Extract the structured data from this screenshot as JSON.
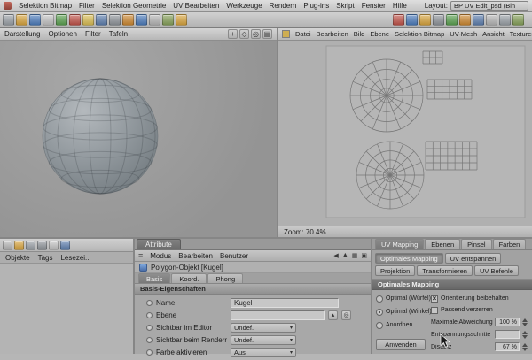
{
  "app": {
    "layout_label": "Layout:",
    "layout_value": "BP UV Edit_psd (Bin"
  },
  "menubar": {
    "items": [
      "Selektion Bitmap",
      "Filter",
      "Selektion Geometrie",
      "UV Bearbeiten",
      "Werkzeuge",
      "Rendern",
      "Plug-ins",
      "Skript",
      "Fenster",
      "Hilfe"
    ]
  },
  "toolbar": {
    "left_icons": [
      "#9aa0a6",
      "#d7a43f",
      "#4d7cbb",
      "#c2c2c2",
      "#5ba051",
      "#c0544a",
      "#d9bd55",
      "#5f7fae",
      "#8f949a",
      "#cc8833",
      "#4d7cbb",
      "#b5b5b5",
      "#86a05a",
      "#d7a43f"
    ],
    "right_icons": [
      "#c0544a",
      "#4d7cbb",
      "#d7a43f",
      "#8f949a",
      "#5ba051",
      "#cc8833",
      "#5f7fae",
      "#b5b5b5",
      "#9aa0a6",
      "#86a05a"
    ]
  },
  "viewport3d": {
    "menu": [
      "Darstellung",
      "Optionen",
      "Filter",
      "Tafeln"
    ]
  },
  "uv_view": {
    "menu": [
      "Datei",
      "Bearbeiten",
      "Bild",
      "Ebene",
      "Selektion Bitmap",
      "UV-Mesh",
      "Ansicht",
      "Texturen"
    ],
    "zoom_text": "Zoom: 70.4%"
  },
  "object_manager": {
    "toolbar_icons": [
      "#b5b5b5",
      "#d7a43f",
      "#9aa0a6",
      "#8f949a",
      "#c2c2c2",
      "#5f7fae"
    ],
    "tabs": [
      "Objekte",
      "Tags",
      "Lesezei..."
    ]
  },
  "attributes": {
    "panel_tab": "Attribute",
    "menu": [
      "Modus",
      "Bearbeiten",
      "Benutzer"
    ],
    "object_title": "Polygon-Objekt [Kugel]",
    "tabs": [
      "Basis",
      "Koord.",
      "Phong"
    ],
    "section": "Basis-Eigenschaften",
    "rows": [
      {
        "label": "Name",
        "value": "Kugel"
      },
      {
        "label": "Ebene",
        "value": ""
      },
      {
        "label": "Sichtbar im Editor",
        "value": "Undef."
      },
      {
        "label": "Sichtbar beim Rendern",
        "value": "Undef."
      },
      {
        "label": "Farbe aktivieren",
        "value": "Aus"
      }
    ]
  },
  "uv_mapping": {
    "tabs": [
      "UV Mapping",
      "Ebenen",
      "Pinsel",
      "Farben"
    ],
    "buttons": [
      "Optimales Mapping",
      "UV entspannen",
      "Projektion",
      "Transformieren",
      "UV Befehle"
    ],
    "section": "Optimales Mapping",
    "radios": [
      {
        "label": "Optimal (Würfel)",
        "selected": false
      },
      {
        "label": "Optimal (Winkel)",
        "selected": true
      },
      {
        "label": "Anordnen",
        "selected": false
      }
    ],
    "checks": [
      {
        "label": "Orientierung beibehalten",
        "checked": true
      },
      {
        "label": "Passend verzerren",
        "checked": false
      }
    ],
    "fields": [
      {
        "label": "Maximale Abweichung",
        "value": "100 %"
      },
      {
        "label": "Entspannungsschritte",
        "value": ""
      },
      {
        "label": "Distanz",
        "value": "67 %"
      }
    ],
    "apply_label": "Anwenden"
  },
  "colors": {
    "viewport_bg": "#9b9b9b",
    "uv_canvas_bg": "#b0b0b0",
    "panel_bg": "#a8a8a8"
  }
}
